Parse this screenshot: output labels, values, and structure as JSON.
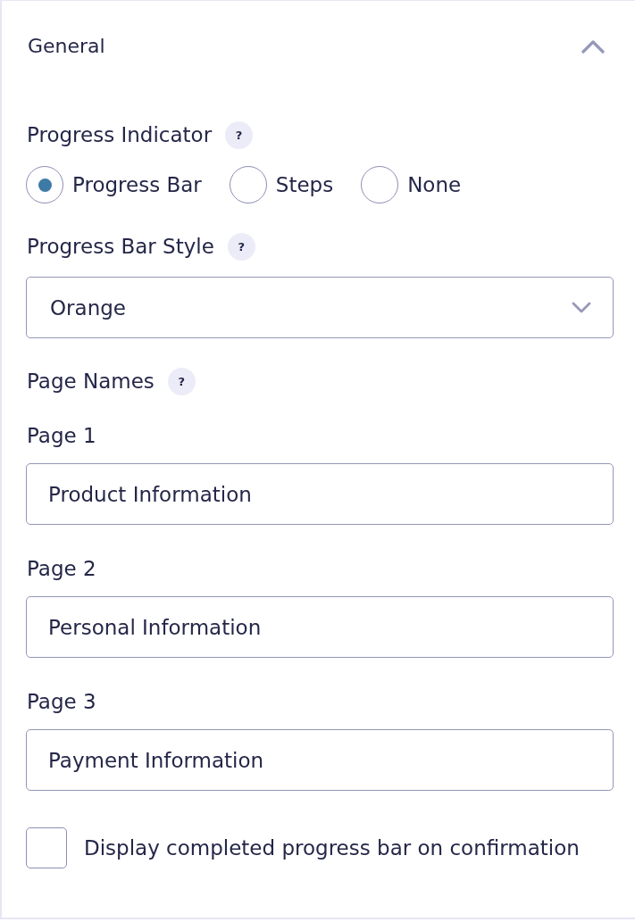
{
  "section": {
    "title": "General",
    "expanded": true
  },
  "progress_indicator": {
    "label": "Progress Indicator",
    "help": "?",
    "options": [
      {
        "label": "Progress Bar",
        "selected": true
      },
      {
        "label": "Steps",
        "selected": false
      },
      {
        "label": "None",
        "selected": false
      }
    ]
  },
  "progress_bar_style": {
    "label": "Progress Bar Style",
    "help": "?",
    "value": "Orange"
  },
  "page_names": {
    "label": "Page Names",
    "help": "?",
    "pages": [
      {
        "label": "Page 1",
        "value": "Product Information"
      },
      {
        "label": "Page 2",
        "value": "Personal Information"
      },
      {
        "label": "Page 3",
        "value": "Payment Information"
      }
    ]
  },
  "confirmation": {
    "label": "Display completed progress bar on confirmation",
    "checked": false
  }
}
